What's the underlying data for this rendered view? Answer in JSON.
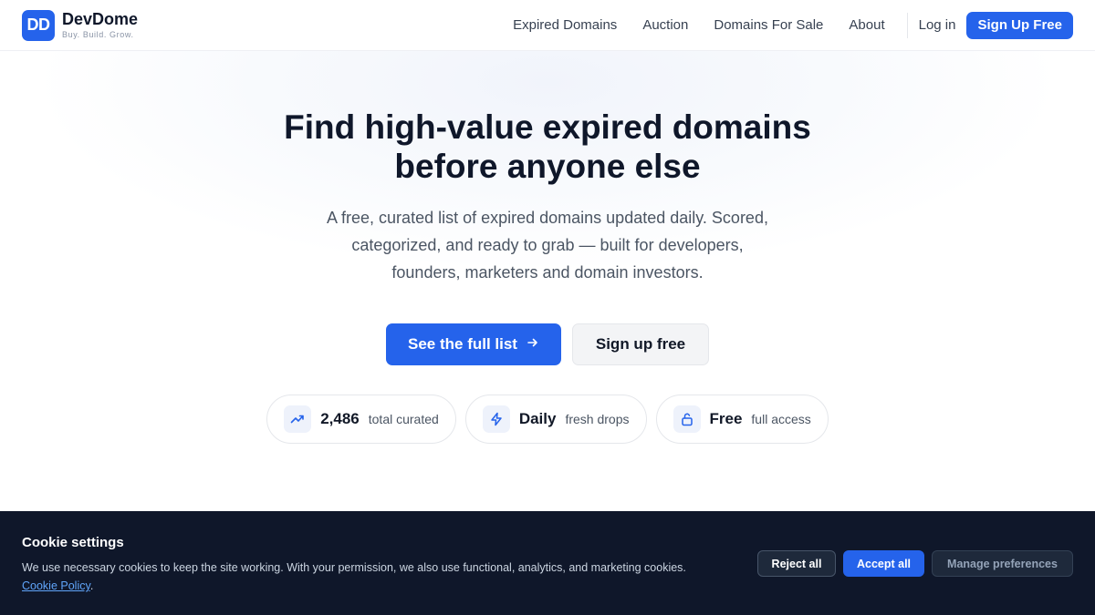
{
  "brand": {
    "logo_mark": "DD",
    "name": "DevDome",
    "tagline": "Buy. Build. Grow.",
    "accent_color": "#2563eb"
  },
  "nav": {
    "links": [
      {
        "label": "Expired Domains"
      },
      {
        "label": "Auction"
      },
      {
        "label": "Domains For Sale"
      },
      {
        "label": "About"
      }
    ],
    "login_label": "Log in",
    "signup_label": "Sign Up Free"
  },
  "hero": {
    "title": "Find high-value expired domains before anyone else",
    "subtitle": "A free, curated list of expired domains updated daily. Scored, categorized, and ready to grab — built for developers, founders, marketers and domain investors.",
    "primary_cta": "See the full list",
    "primary_cta_icon": "arrow-right-icon",
    "secondary_cta": "Sign up free"
  },
  "stats": [
    {
      "icon": "trending-up-icon",
      "value": "2,486",
      "label": "total curated"
    },
    {
      "icon": "lightning-icon",
      "value": "Daily",
      "label": "fresh drops"
    },
    {
      "icon": "unlock-icon",
      "value": "Free",
      "label": "full access"
    }
  ],
  "cookie": {
    "title": "Cookie settings",
    "text": "We use necessary cookies to keep the site working. With your permission, we also use functional, analytics, and marketing cookies.",
    "link_label": "Cookie Policy",
    "link_suffix": ".",
    "reject_label": "Reject all",
    "accept_label": "Accept all",
    "manage_label": "Manage preferences"
  }
}
